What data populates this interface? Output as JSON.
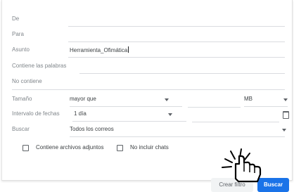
{
  "form": {
    "from_label": "De",
    "to_label": "Para",
    "subject_label": "Asunto",
    "subject_value": "Herramienta_Ofimática",
    "has_words_label": "Contiene las palabras",
    "not_contains_label": "No contiene",
    "size_label": "Tamaño",
    "size_operator": "mayor que",
    "size_unit": "MB",
    "date_range_label": "Intervalo de fechas",
    "date_range_value": "1 día",
    "search_label": "Buscar",
    "search_scope": "Todos los correos",
    "attachments_label": "Contiene archivos adjuntos",
    "no_chats_label": "No incluir chats"
  },
  "buttons": {
    "create_filter": "Crear filtro",
    "search": "Buscar"
  },
  "colors": {
    "accent": "#1a73e8",
    "line": "#dadce0"
  }
}
